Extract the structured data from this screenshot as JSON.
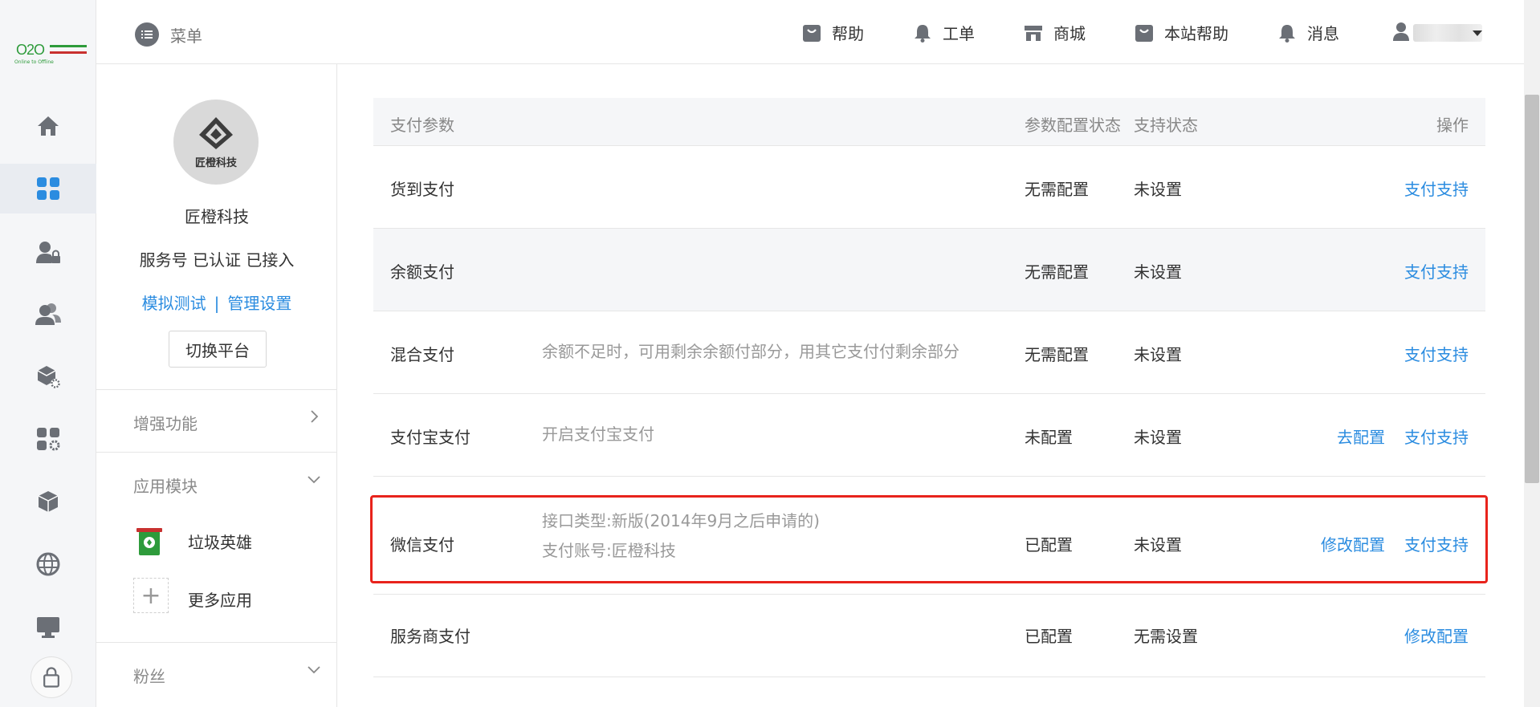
{
  "header": {
    "menu_label": "菜单",
    "nav": [
      {
        "label": "帮助",
        "icon": "bag-icon"
      },
      {
        "label": "工单",
        "icon": "bell-icon"
      },
      {
        "label": "商城",
        "icon": "store-icon"
      },
      {
        "label": "本站帮助",
        "icon": "bag-icon"
      },
      {
        "label": "消息",
        "icon": "bell-icon"
      }
    ],
    "user_icon": "user-icon"
  },
  "logo": {
    "big": "O2O",
    "small": "Online to Offline"
  },
  "rail": {
    "items": [
      "home-icon",
      "dashboard-grid-icon",
      "user-lock-icon",
      "users-icon",
      "box-settings-icon",
      "grid-settings-icon",
      "cube-icon",
      "globe-icon",
      "monitor-icon"
    ],
    "active_index": 1
  },
  "account": {
    "logo_text": "匠橙科技",
    "name": "匠橙科技",
    "status": "服务号 已认证 已接入",
    "link_test": "模拟测试",
    "link_sep": "|",
    "link_manage": "管理设置",
    "switch_label": "切换平台"
  },
  "sections": {
    "enhanced": "增强功能",
    "modules": "应用模块",
    "fans": "粉丝"
  },
  "apps": {
    "trash_hero": "垃圾英雄",
    "more_apps": "更多应用"
  },
  "table": {
    "headers": {
      "param": "支付参数",
      "config_status": "参数配置状态",
      "support_status": "支持状态",
      "actions": "操作"
    },
    "rows": [
      {
        "name": "货到支付",
        "desc1": "",
        "desc2": "",
        "config": "无需配置",
        "support": "未设置",
        "op1": "",
        "op2": "支付支持"
      },
      {
        "name": "余额支付",
        "desc1": "",
        "desc2": "",
        "config": "无需配置",
        "support": "未设置",
        "op1": "",
        "op2": "支付支持"
      },
      {
        "name": "混合支付",
        "desc1": "余额不足时，可用剩余余额付部分，用其它支付付剩余部分",
        "desc2": "",
        "config": "无需配置",
        "support": "未设置",
        "op1": "",
        "op2": "支付支持"
      },
      {
        "name": "支付宝支付",
        "desc1": "开启支付宝支付",
        "desc2": "",
        "config": "未配置",
        "support": "未设置",
        "op1": "去配置",
        "op2": "支付支持"
      },
      {
        "name": "微信支付",
        "desc1": "接口类型:新版(2014年9月之后申请的)",
        "desc2": "支付账号:匠橙科技",
        "config": "已配置",
        "support": "未设置",
        "op1": "修改配置",
        "op2": "支付支持"
      },
      {
        "name": "服务商支付",
        "desc1": "",
        "desc2": "",
        "config": "已配置",
        "support": "无需设置",
        "op1": "",
        "op2": "修改配置"
      }
    ]
  },
  "colors": {
    "link": "#2b8ce0",
    "highlight": "#e8231c",
    "brand_green": "#2e9b3b"
  }
}
